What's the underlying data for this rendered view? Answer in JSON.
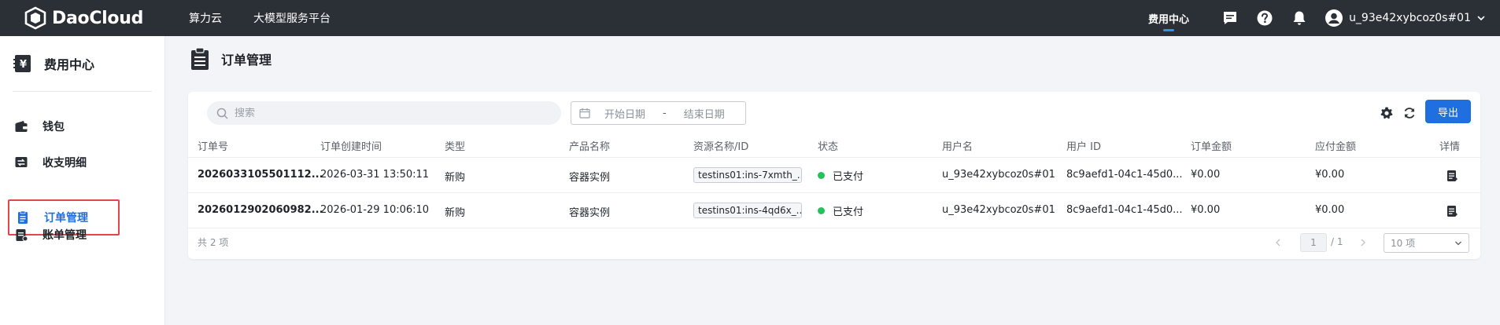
{
  "topbar": {
    "brand": "DaoCloud",
    "nav": [
      "算力云",
      "大模型服务平台"
    ],
    "fee_center": "费用中心",
    "username": "u_93e42xybcoz0s#01"
  },
  "sidebar": {
    "title": "费用中心",
    "items": [
      {
        "label": "钱包",
        "icon": "wallet-icon"
      },
      {
        "label": "收支明细",
        "icon": "transactions-icon"
      },
      {
        "label": "订单管理",
        "icon": "orders-icon"
      },
      {
        "label": "账单管理",
        "icon": "bills-icon"
      }
    ]
  },
  "page": {
    "title": "订单管理"
  },
  "toolbar": {
    "search_placeholder": "搜索",
    "date_start_placeholder": "开始日期",
    "date_sep": "-",
    "date_end_placeholder": "结束日期",
    "export_label": "导出"
  },
  "table": {
    "columns": [
      "订单号",
      "订单创建时间",
      "类型",
      "产品名称",
      "资源名称/ID",
      "状态",
      "用户名",
      "用户 ID",
      "订单金额",
      "应付金额",
      "详情"
    ],
    "rows": [
      {
        "order_id": "2026033105501112...",
        "created": "2026-03-31 13:50:11",
        "type": "新购",
        "product": "容器实例",
        "resource": "testins01:ins-7xmth_...",
        "status": "已支付",
        "username": "u_93e42xybcoz0s#01",
        "user_id": "8c9aefd1-04c1-45d0...",
        "amount": "¥0.00",
        "payable": "¥0.00"
      },
      {
        "order_id": "2026012902060982...",
        "created": "2026-01-29 10:06:10",
        "type": "新购",
        "product": "容器实例",
        "resource": "testins01:ins-4qd6x_...",
        "status": "已支付",
        "username": "u_93e42xybcoz0s#01",
        "user_id": "8c9aefd1-04c1-45d0...",
        "amount": "¥0.00",
        "payable": "¥0.00"
      }
    ]
  },
  "pagination": {
    "total_text": "共 2 项",
    "current_page": "1",
    "total_pages": "/ 1",
    "page_size": "10 项"
  },
  "colors": {
    "accent": "#1f6fe0",
    "topbar": "#2b2f36",
    "status_paid": "#23c25b",
    "highlight_border": "#e0464c"
  }
}
